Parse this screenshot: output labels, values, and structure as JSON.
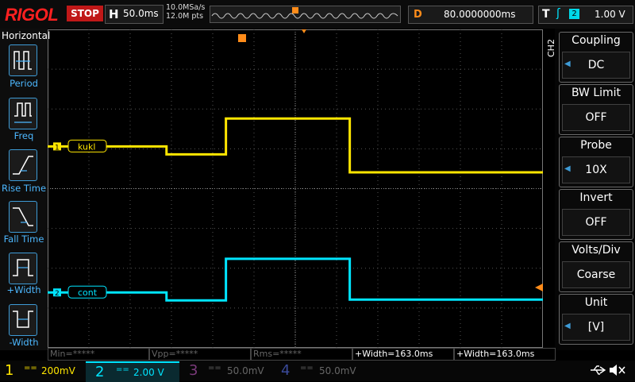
{
  "brand": "RIGOL",
  "run_state": "STOP",
  "timebase": {
    "letter": "H",
    "value": "50.0ms"
  },
  "sample_rate": "10.0MSa/s",
  "memory_depth": "12.0M pts",
  "delay": {
    "letter": "D",
    "value": "80.0000000ms"
  },
  "trigger": {
    "letter": "T",
    "source": "2",
    "level": "1.00 V"
  },
  "left_panel": {
    "title": "Horizontal",
    "items": [
      {
        "label": "Period",
        "icon": "period-icon"
      },
      {
        "label": "Freq",
        "icon": "freq-icon"
      },
      {
        "label": "Rise Time",
        "icon": "rise-time-icon"
      },
      {
        "label": "Fall Time",
        "icon": "fall-time-icon"
      },
      {
        "label": "+Width",
        "icon": "positive-width-icon"
      },
      {
        "label": "-Width",
        "icon": "negative-width-icon"
      }
    ]
  },
  "right_panel": {
    "channel": "CH2",
    "items": [
      {
        "title": "Coupling",
        "value": "DC",
        "arrow": true
      },
      {
        "title": "BW Limit",
        "value": "OFF",
        "arrow": false
      },
      {
        "title": "Probe",
        "value": "10X",
        "arrow": true
      },
      {
        "title": "Invert",
        "value": "OFF",
        "arrow": false
      },
      {
        "title": "Volts/Div",
        "value": "Coarse",
        "arrow": false
      },
      {
        "title": "Unit",
        "value": "[V]",
        "arrow": true
      }
    ]
  },
  "measurements": [
    {
      "text": "Min=*****",
      "active": false
    },
    {
      "text": "Vpp=*****",
      "active": false
    },
    {
      "text": "Rms=*****",
      "active": false
    },
    {
      "text": "+Width=163.0ms",
      "active": true
    },
    {
      "text": "+Width=163.0ms",
      "active": true
    }
  ],
  "channels": [
    {
      "num": "1",
      "coupling": "==",
      "scale": "200mV",
      "color": "#ffe600",
      "active": true
    },
    {
      "num": "2",
      "coupling": "==",
      "scale": "2.00 V",
      "color": "#00e5ff",
      "active": true
    },
    {
      "num": "3",
      "coupling": "==",
      "scale": "50.0mV",
      "color": "#c040c0",
      "active": false
    },
    {
      "num": "4",
      "coupling": "==",
      "scale": "50.0mV",
      "color": "#4a70ff",
      "active": false
    }
  ],
  "traces": [
    {
      "label": "kukl",
      "marker": "1",
      "color": "#ffe600",
      "segments": [
        [
          0,
          0.21
        ],
        [
          0.24,
          0.17
        ],
        [
          0.36,
          0.35
        ],
        [
          0.61,
          0.08
        ],
        [
          1.0,
          0.08
        ]
      ]
    },
    {
      "label": "cont",
      "marker": "2",
      "color": "#00e5ff",
      "segments": [
        [
          0,
          0.71
        ],
        [
          0.24,
          0.31
        ],
        [
          0.36,
          2.4
        ],
        [
          0.61,
          0.35
        ],
        [
          1.0,
          0.35
        ]
      ]
    }
  ],
  "colors": {
    "accent": "#3e9bd6",
    "trigger_orange": "#ff8c1a",
    "stop_red": "#c01818",
    "logo_red": "#ff2020"
  }
}
